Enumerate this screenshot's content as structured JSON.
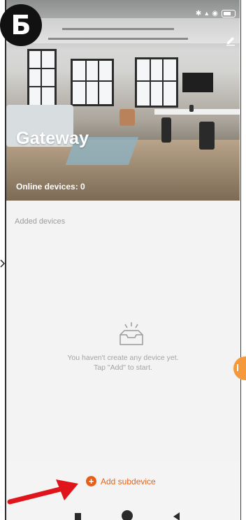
{
  "badge": {
    "letter": "Б"
  },
  "header": {
    "title": "Gateway",
    "online_devices": "Online devices: 0"
  },
  "content": {
    "section_label": "Added devices",
    "empty_line1": "You haven't create any device yet.",
    "empty_line2": "Tap \"Add\" to start."
  },
  "footer": {
    "add_label": "Add subdevice"
  },
  "colors": {
    "accent": "#e85d17",
    "annotation_arrow": "#e0141b",
    "side_tab": "#f59a3c"
  },
  "icons": [
    "bluetooth-icon",
    "signal-icon",
    "wifi-icon",
    "battery-icon",
    "edit-icon",
    "empty-box-icon",
    "plus-circle-icon",
    "red-arrow-annotation",
    "nav-recents-icon",
    "nav-home-icon",
    "nav-back-icon"
  ]
}
